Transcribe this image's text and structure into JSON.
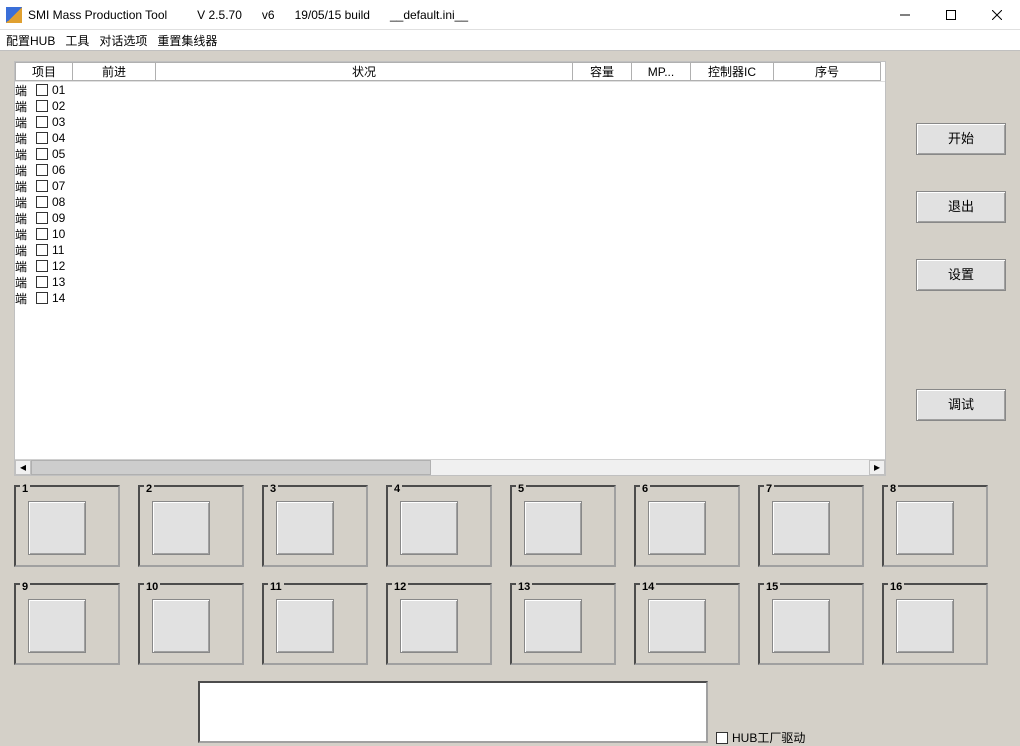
{
  "titlebar": {
    "app": "SMI Mass Production Tool",
    "version1": "V 2.5.70",
    "version2": "v6",
    "build": "19/05/15 build",
    "ini": "__default.ini__"
  },
  "menu": {
    "hub": "配置HUB",
    "tools": "工具",
    "dialog": "对话选项",
    "resethub": "重置集线器"
  },
  "columns": {
    "project": "项目",
    "forward": "前进",
    "status": "状况",
    "capacity": "容量",
    "mp": "MP...",
    "controller": "控制器IC",
    "serial": "序号"
  },
  "rows": [
    {
      "label": "端",
      "num": "01"
    },
    {
      "label": "端",
      "num": "02"
    },
    {
      "label": "端",
      "num": "03"
    },
    {
      "label": "端",
      "num": "04"
    },
    {
      "label": "端",
      "num": "05"
    },
    {
      "label": "端",
      "num": "06"
    },
    {
      "label": "端",
      "num": "07"
    },
    {
      "label": "端",
      "num": "08"
    },
    {
      "label": "端",
      "num": "09"
    },
    {
      "label": "端",
      "num": "10"
    },
    {
      "label": "端",
      "num": "11"
    },
    {
      "label": "端",
      "num": "12"
    },
    {
      "label": "端",
      "num": "13"
    },
    {
      "label": "端",
      "num": "14"
    }
  ],
  "buttons": {
    "start": "开始",
    "exit": "退出",
    "settings": "设置",
    "debug": "调试"
  },
  "ports": [
    "1",
    "2",
    "3",
    "4",
    "5",
    "6",
    "7",
    "8",
    "9",
    "10",
    "11",
    "12",
    "13",
    "14",
    "15",
    "16"
  ],
  "hubCheck": "HUB工厂驱动"
}
